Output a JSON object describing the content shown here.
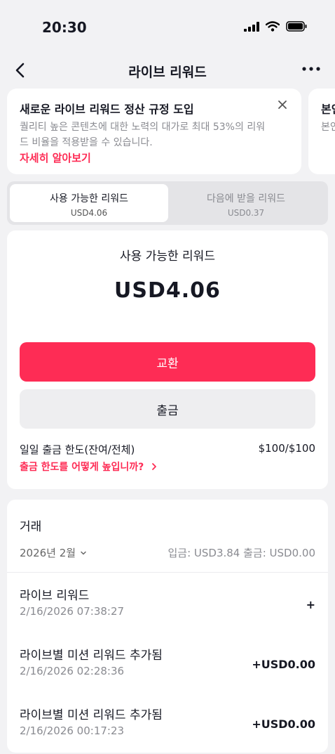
{
  "status": {
    "time": "20:30"
  },
  "nav": {
    "title": "라이브 리워드"
  },
  "banner": {
    "title": "새로운 라이브 리워드 정산 규정 도입",
    "body": "퀄리티 높은 콘텐츠에 대한 노력의 대가로 최대 53%의 리워드 비율을 적용받을 수 있습니다.",
    "link": "자세히 알아보기"
  },
  "banner_peek": {
    "title": "본인",
    "body": "본인"
  },
  "tabs": [
    {
      "label": "사용 가능한 리워드",
      "amount": "USD4.06"
    },
    {
      "label": "다음에 받을 리워드",
      "amount": "USD0.37"
    }
  ],
  "balance": {
    "title": "사용 가능한 리워드",
    "amount": "USD4.06",
    "note": "",
    "exchange_label": "교환",
    "withdraw_label": "출금",
    "limit_label": "일일 출금 한도(잔여/전체)",
    "limit_value": "$100/$100",
    "limit_link": "출금 한도를 어떻게 높입니까?"
  },
  "transactions": {
    "title": "거래",
    "month": "2026년 2월",
    "summary": "입금: USD3.84   출금: USD0.00",
    "items": [
      {
        "name": "라이브 리워드",
        "date": "2/16/2026 07:38:27",
        "amount": "+"
      },
      {
        "name": "라이브별 미션 리워드 추가됨",
        "date": "2/16/2026 02:28:36",
        "amount": "+USD0.00"
      },
      {
        "name": "라이브별 미션 리워드 추가됨",
        "date": "2/16/2026 00:17:23",
        "amount": "+USD0.00"
      }
    ]
  },
  "colors": {
    "accent": "#fe2c55",
    "background": "#f2f2f4",
    "card": "#ffffff",
    "muted": "#8a8b91"
  },
  "icons": [
    "signal-icon",
    "wifi-icon",
    "battery-icon",
    "back-arrow-icon",
    "more-icon",
    "close-icon",
    "chevron-right-icon",
    "chevron-down-icon"
  ]
}
